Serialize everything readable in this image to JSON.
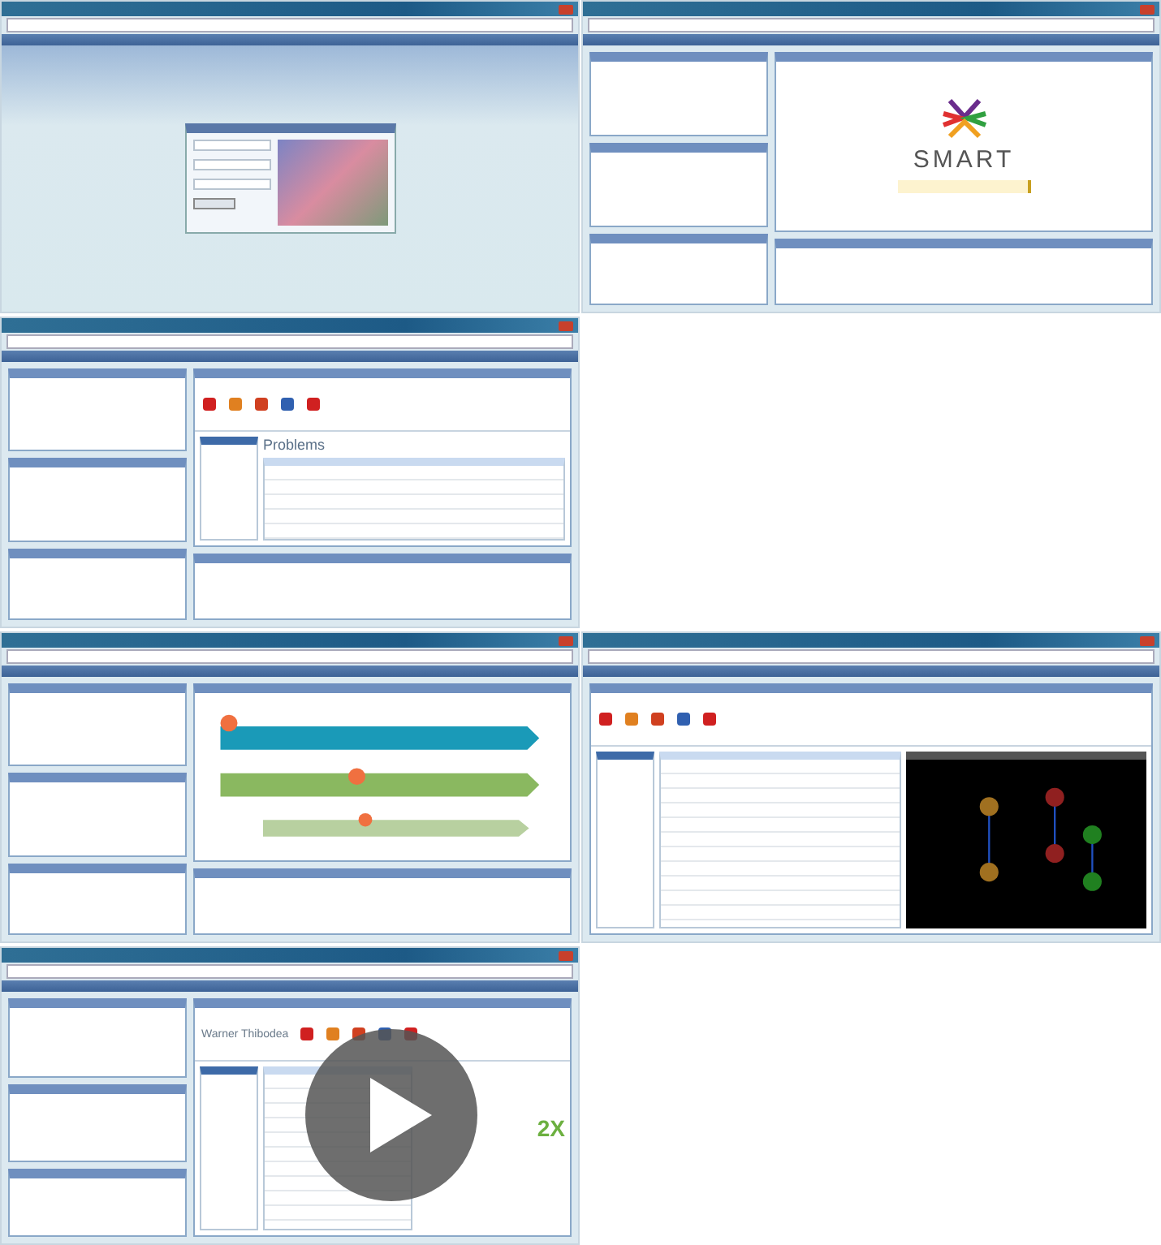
{
  "screens": [
    {
      "kind": "login"
    },
    {
      "kind": "smart",
      "logo": "SMART"
    },
    {
      "kind": "problems",
      "heading": "Problems"
    },
    {
      "kind": "timeline"
    },
    {
      "kind": "medications"
    },
    {
      "kind": "video",
      "patient": "Warner Thibodea",
      "badge": "2X"
    }
  ]
}
